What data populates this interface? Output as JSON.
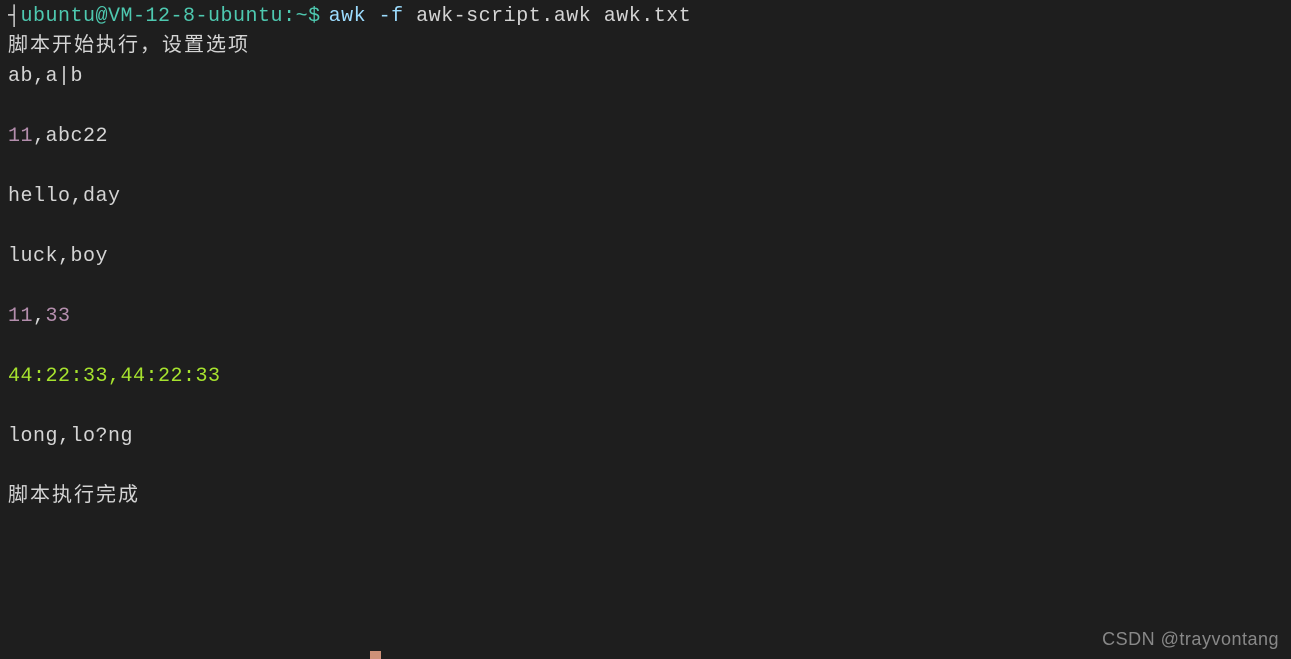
{
  "prompt": {
    "bracket_open": "┤",
    "user_host": "ubuntu@VM-12-8-ubuntu",
    "colon": ":",
    "path": "~",
    "dollar": "$"
  },
  "command": {
    "awk": "awk",
    "flag": "-f",
    "script": "awk-script.awk",
    "file": "awk.txt"
  },
  "output": {
    "line1": "脚本开始执行，设置选项",
    "line2": "ab,a|b",
    "line3_a": "11",
    "line3_b": ",abc22",
    "line4": "hello,day",
    "line5": "luck,boy",
    "line6_a": "11",
    "line6_b": ",",
    "line6_c": "33",
    "line7": "44:22:33,44:22:33",
    "line8": "long,lo?ng",
    "line9": "脚本执行完成"
  },
  "watermark": "CSDN @trayvontang"
}
